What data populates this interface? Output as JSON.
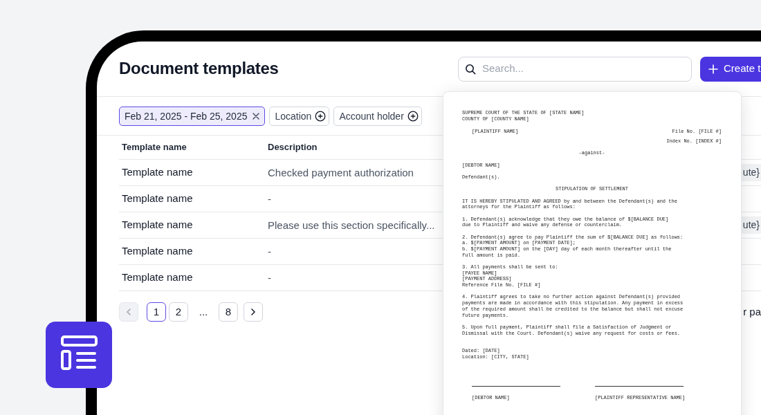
{
  "app_icon": {
    "kind": "badge"
  },
  "title": "Document templates",
  "search": {
    "placeholder": "Search..."
  },
  "create_button": {
    "label": "Create t"
  },
  "filters": [
    {
      "label": "Feb 21, 2025 - Feb 25, 2025",
      "kind": "applied"
    },
    {
      "label": "Location",
      "kind": "add"
    },
    {
      "label": "Account holder",
      "kind": "add"
    }
  ],
  "table": {
    "columns": [
      "Template name",
      "Description"
    ],
    "rows": [
      {
        "name": "Template name",
        "description": "Checked payment authorization",
        "column_3": "ute}"
      },
      {
        "name": "Template name",
        "description": "-"
      },
      {
        "name": "Template name",
        "description": "Please use this section specifically...",
        "column_3": "ute}"
      },
      {
        "name": "Template name",
        "description": "-"
      },
      {
        "name": "Template name",
        "description": "-"
      }
    ]
  },
  "pagination": {
    "previous": {
      "disabled": true
    },
    "next": {
      "disabled": false
    },
    "pages": [
      {
        "label": "1",
        "kind": "page",
        "selected": true
      },
      {
        "label": "2",
        "kind": "page",
        "selected": false
      },
      {
        "label": "...",
        "kind": "ellipsis"
      },
      {
        "label": "8",
        "kind": "page",
        "selected": false
      }
    ],
    "rows_per_page": "r pa"
  },
  "document": {
    "blocks": [
      {
        "kind": "left",
        "text": "SUPREME COURT OF THE STATE OF [STATE NAME]\nCOUNTY OF [COUNTY NAME]"
      },
      {
        "kind": "pair",
        "left": "[PLAINTIFF NAME]",
        "right": "File No. [FILE #]"
      },
      {
        "kind": "right",
        "text": "Index No. [INDEX #]"
      },
      {
        "kind": "center",
        "text": "-against-"
      },
      {
        "kind": "left",
        "text": "[DEBTOR NAME]"
      },
      {
        "kind": "left",
        "text": "Defendant(s)."
      },
      {
        "kind": "center",
        "text": "STIPULATION OF SETTLEMENT"
      },
      {
        "kind": "paragraph",
        "text": "IT IS HEREBY STIPULATED AND AGREED by and between the Defendant(s) and the\nattorneys for the Plaintiff as follows:"
      },
      {
        "kind": "paragraph",
        "text": "1. Defendant(s) acknowledge that they owe the balance of $[BALANCE DUE]\ndue to Plaintiff and waive any defense or counterclaim."
      },
      {
        "kind": "paragraph",
        "text": "2. Defendant(s) agree to pay Plaintiff the sum of $[BALANCE DUE] as follows:\na. $[PAYMENT AMOUNT] on [PAYMENT DATE];\nb. $[PAYMENT AMOUNT] on the [DAY] day of each month thereafter until the\nfull amount is paid."
      },
      {
        "kind": "paragraph",
        "text": "3. All payments shall be sent to:\n[PAYEE NAME]\n[PAYMENT ADDRESS]\nReference File No. [FILE #]"
      },
      {
        "kind": "paragraph",
        "text": "4. Plaintiff agrees to take no further action against Defendant(s) provided\npayments are made in accordance with this stipulation. Any payment in excess\nof the required amount shall be credited to the balance but shall not excuse\nfuture payments."
      },
      {
        "kind": "paragraph",
        "text": "5. Upon full payment, Plaintiff shall file a Satisfaction of Judgment or\nDismissal with the Court. Defendant(s) waive any request for costs or fees."
      },
      {
        "kind": "dated",
        "text": "Dated: [DATE]\nLocation: [CITY, STATE]"
      },
      {
        "kind": "signatures",
        "names": [
          "[DEBTOR NAME]",
          "[PLAINTIFF REPRESENTATIVE NAME]"
        ]
      }
    ]
  }
}
